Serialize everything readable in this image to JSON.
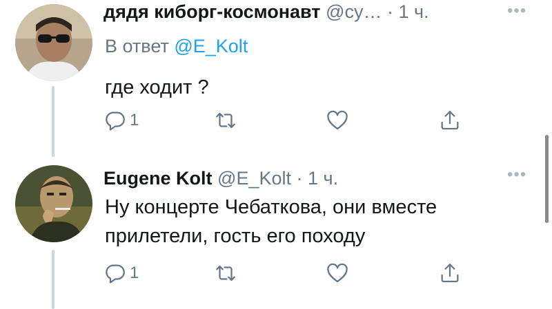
{
  "tweets": [
    {
      "name": "дядя киборг-космонавт",
      "handle": "@су…",
      "separator": "·",
      "time": "1 ч.",
      "reply_prefix": "В ответ",
      "reply_to": "@E_Kolt",
      "text": "где ходит ?",
      "reply_count": "1",
      "icons": {
        "reply": "reply-icon",
        "retweet": "retweet-icon",
        "like": "heart-icon",
        "share": "share-icon",
        "more": "more-icon"
      }
    },
    {
      "name": "Eugene Kolt",
      "handle": "@E_Kolt",
      "separator": "·",
      "time": "1 ч.",
      "text": "Ну концерте Чебаткова, они вместе прилетели, гость его походу",
      "reply_count": "1",
      "icons": {
        "reply": "reply-icon",
        "retweet": "retweet-icon",
        "like": "heart-icon",
        "share": "share-icon",
        "more": "more-icon"
      }
    }
  ],
  "more_glyph": "•••",
  "colors": {
    "accent": "#1da1f2",
    "secondary_text": "#657786",
    "icon": "#657786",
    "thread_line": "#ccd6dd"
  }
}
